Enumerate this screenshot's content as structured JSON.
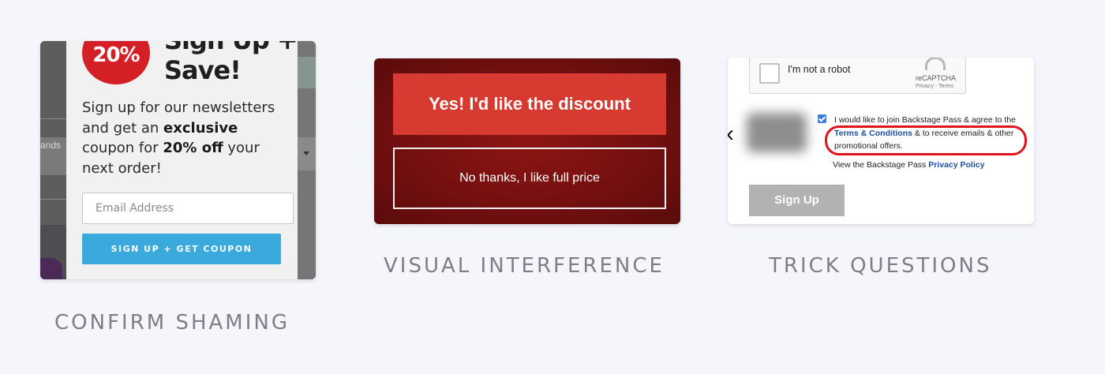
{
  "confirm_shaming": {
    "caption": "CONFIRM SHAMING",
    "badge": "20%",
    "headline": "Sign Up + Save!",
    "description_parts": [
      "Sign up for our newsletters and get an ",
      "exclusive",
      " coupon for ",
      "20% off",
      " your next order!"
    ],
    "email_placeholder": "Email Address",
    "cta_label": "SIGN UP + GET COUPON",
    "background_fragment": "rands",
    "colors": {
      "badge": "#d41f26",
      "cta": "#3aa9dc"
    }
  },
  "visual_interference": {
    "caption": "VISUAL INTERFERENCE",
    "accept_label": "Yes! I'd like the discount",
    "decline_label": "No thanks, I like full price",
    "colors": {
      "background": "#741010",
      "accept": "#d63a31"
    }
  },
  "trick_questions": {
    "caption": "TRICK QUESTIONS",
    "captcha_label": "I'm not a robot",
    "captcha_brand": "reCAPTCHA",
    "captcha_links": "Privacy - Terms",
    "agree_text_start": "I would like to join Backstage Pass & agree to the ",
    "terms_link": "Terms & Conditions",
    "agree_text_end": " & to receive emails & other promotional offers.",
    "privacy_text": "View the Backstage Pass ",
    "privacy_link": "Privacy Policy",
    "signup_label": "Sign Up",
    "checkbox_checked": true,
    "colors": {
      "highlight_ring": "#e0151c",
      "link": "#1f4fa0",
      "signup": "#b2b2b2"
    }
  }
}
